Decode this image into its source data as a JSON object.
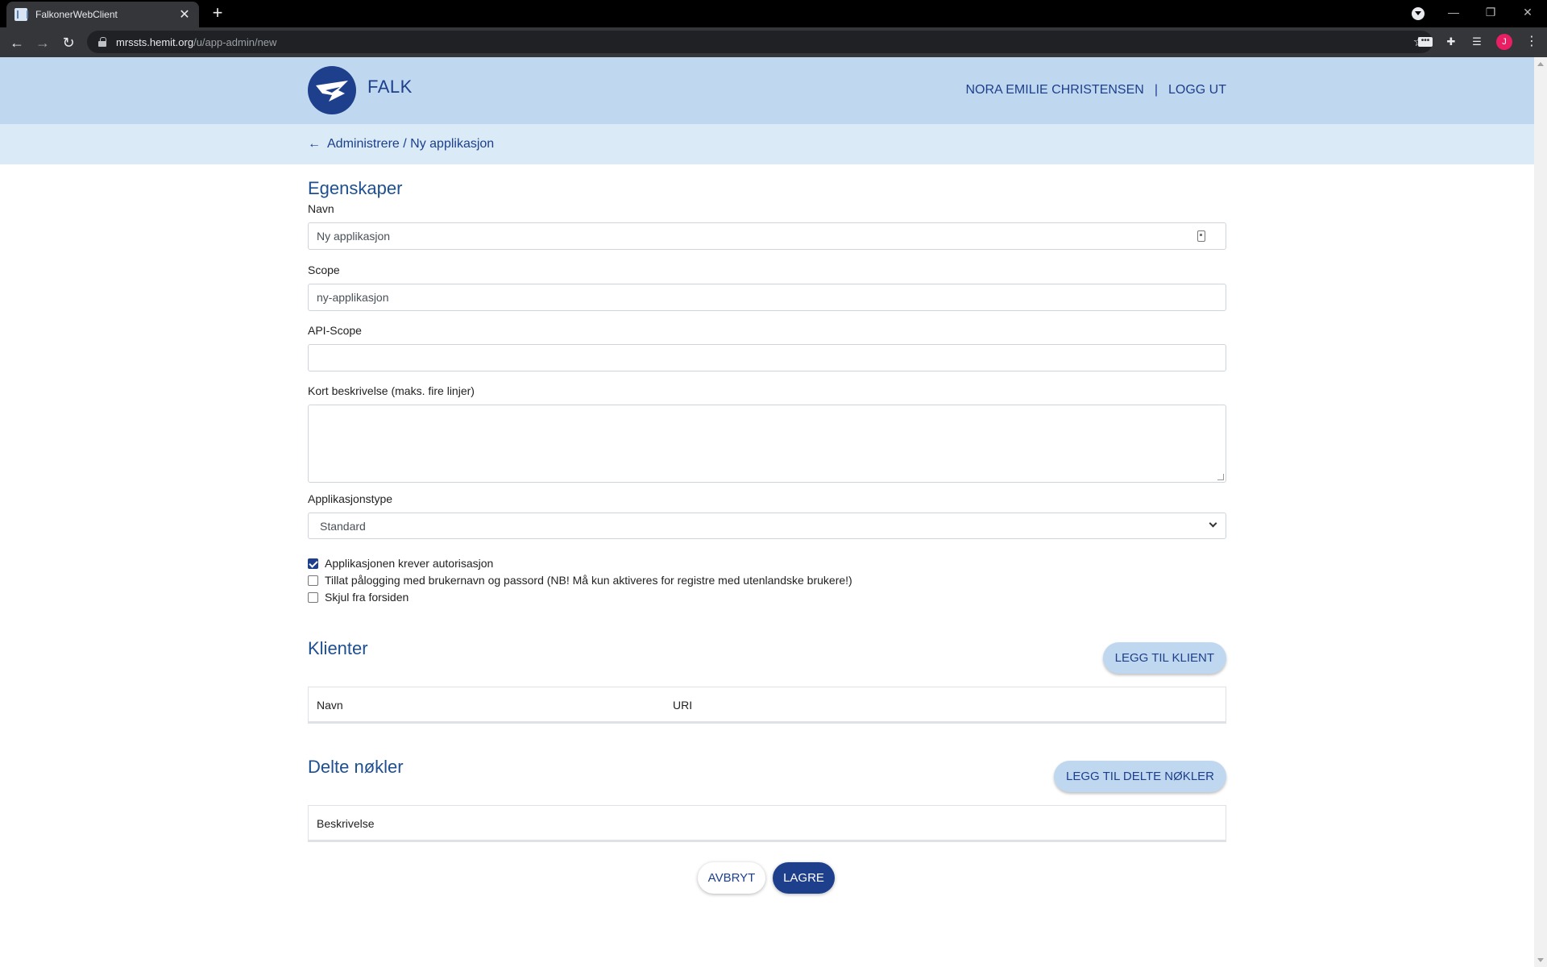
{
  "browser": {
    "tab_title": "FalkonerWebClient",
    "tab_close": "✕",
    "new_tab": "+",
    "url_host": "mrssts.hemit.org",
    "url_path": "/u/app-admin/new",
    "avatar_letter": "J",
    "window_minimize": "—",
    "window_restore": "❐",
    "window_close": "✕"
  },
  "header": {
    "brand": "FALK",
    "user_name": "NORA EMILIE CHRISTENSEN",
    "separator": "|",
    "logout": "LOGG UT",
    "colors": {
      "header_bg": "#c0d8ef",
      "primary": "#1d3f8c"
    }
  },
  "breadcrumb": {
    "text": "Administrere / Ny applikasjon"
  },
  "properties": {
    "heading": "Egenskaper",
    "name": {
      "label": "Navn",
      "value": "Ny applikasjon"
    },
    "scope": {
      "label": "Scope",
      "value": "ny-applikasjon"
    },
    "api_scope": {
      "label": "API-Scope",
      "value": ""
    },
    "description": {
      "label": "Kort beskrivelse (maks. fire linjer)",
      "value": ""
    },
    "app_type": {
      "label": "Applikasjonstype",
      "selected": "Standard"
    },
    "checkboxes": [
      {
        "label": "Applikasjonen krever autorisasjon",
        "checked": true
      },
      {
        "label": "Tillat pålogging med brukernavn og passord (NB! Må kun aktiveres for registre med utenlandske brukere!)",
        "checked": false
      },
      {
        "label": "Skjul fra forsiden",
        "checked": false
      }
    ]
  },
  "clients": {
    "heading": "Klienter",
    "add_button": "LEGG TIL KLIENT",
    "columns": [
      "Navn",
      "URI"
    ]
  },
  "shared_keys": {
    "heading": "Delte nøkler",
    "add_button": "LEGG TIL DELTE NØKLER",
    "columns": [
      "Beskrivelse"
    ]
  },
  "actions": {
    "cancel": "AVBRYT",
    "save": "LAGRE"
  }
}
